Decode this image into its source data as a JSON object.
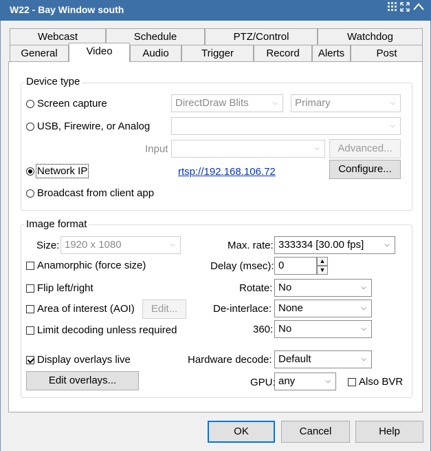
{
  "window": {
    "title": "W22 - Bay Window south"
  },
  "tabs_top": [
    "Webcast",
    "Schedule",
    "PTZ/Control",
    "Watchdog"
  ],
  "tabs_bottom": [
    "General",
    "Video",
    "Audio",
    "Trigger",
    "Record",
    "Alerts",
    "Post"
  ],
  "active_tab": "Video",
  "device_type": {
    "group_label": "Device type",
    "screen_capture": {
      "label": "Screen capture",
      "selected": false,
      "combo1": "DirectDraw Blits",
      "combo2": "Primary"
    },
    "usb": {
      "label": "USB, Firewire, or Analog",
      "selected": false,
      "combo": "",
      "input_label": "Input",
      "input_combo": "",
      "advanced_button": "Advanced..."
    },
    "network_ip": {
      "label": "Network IP",
      "selected": true,
      "url": "rtsp://192.168.106.72",
      "configure_button": "Configure..."
    },
    "broadcast": {
      "label": "Broadcast from client app",
      "selected": false
    }
  },
  "image_format": {
    "group_label": "Image format",
    "size_label": "Size:",
    "size_value": "1920 x 1080",
    "anamorphic": {
      "label": "Anamorphic (force size)",
      "checked": false
    },
    "flip": {
      "label": "Flip left/right",
      "checked": false
    },
    "aoi": {
      "label": "Area of interest (AOI)",
      "checked": false,
      "edit_button": "Edit..."
    },
    "limit_decoding": {
      "label": "Limit decoding unless required",
      "checked": false
    },
    "display_overlays": {
      "label": "Display overlays live",
      "checked": true
    },
    "edit_overlays_button": "Edit overlays...",
    "max_rate_label": "Max. rate:",
    "max_rate_value": "333334 [30.00 fps]",
    "delay_label": "Delay (msec):",
    "delay_value": "0",
    "rotate_label": "Rotate:",
    "rotate_value": "No",
    "deinterlace_label": "De-interlace:",
    "deinterlace_value": "None",
    "label_360": "360:",
    "value_360": "No",
    "hw_decode_label": "Hardware decode:",
    "hw_decode_value": "Default",
    "gpu_label": "GPU:",
    "gpu_value": "any",
    "also_bvr": {
      "label": "Also BVR",
      "checked": false
    }
  },
  "footer": {
    "ok": "OK",
    "cancel": "Cancel",
    "help": "Help"
  }
}
